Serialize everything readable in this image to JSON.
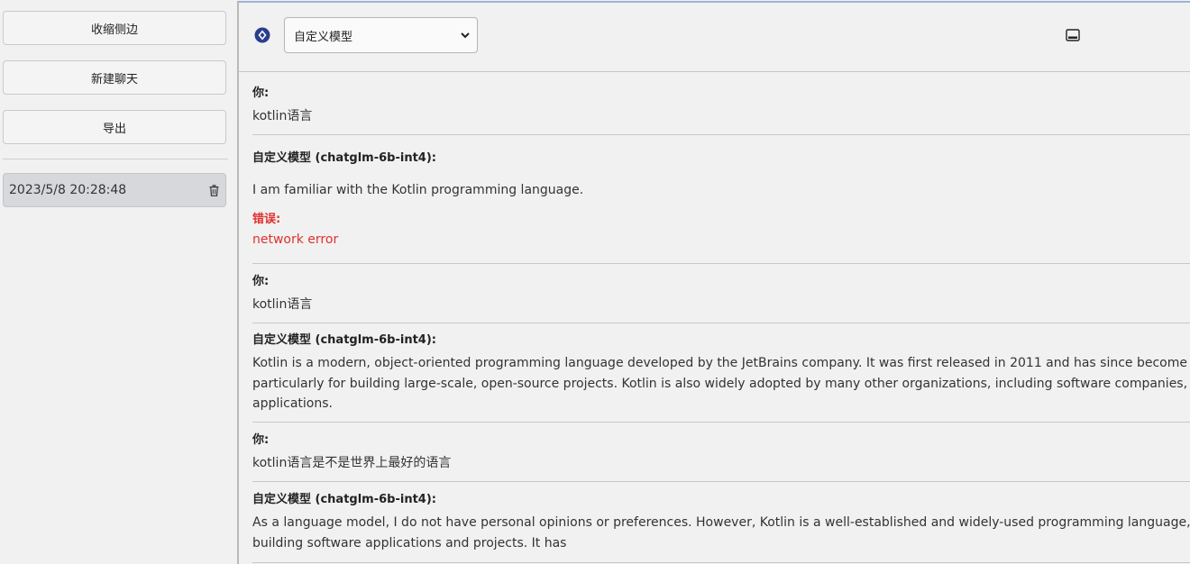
{
  "sidebar": {
    "collapse_label": "收缩侧边",
    "new_chat_label": "新建聊天",
    "export_label": "导出",
    "chats": [
      {
        "label": "2023/5/8 20:28:48"
      }
    ]
  },
  "header": {
    "model_selected": "自定义模型"
  },
  "messages": [
    {
      "speaker": "你:",
      "text": "kotlin语言"
    },
    {
      "speaker": "自定义模型 (chatglm-6b-int4):",
      "text": "I am familiar with the Kotlin programming language.",
      "error_label": "错误:",
      "error_text": "network error"
    },
    {
      "speaker": "你:",
      "text": "kotlin语言"
    },
    {
      "speaker": "自定义模型 (chatglm-6b-int4):",
      "lines": [
        "Kotlin is a modern, object-oriented programming language developed by the JetBrains company. It was first released in 2011 and has since become a popu",
        "particularly for building large-scale, open-source projects. Kotlin is also widely adopted by many other organizations, including software companies, univers",
        "applications."
      ]
    },
    {
      "speaker": "你:",
      "text": "kotlin语言是不是世界上最好的语言"
    },
    {
      "speaker": "自定义模型 (chatglm-6b-int4):",
      "lines": [
        "As a language model, I do not have personal opinions or preferences. However, Kotlin is a well-established and widely-used programming language, and m",
        "building software applications and projects. It has"
      ]
    }
  ],
  "colors": {
    "error": "#e0312e",
    "accent": "#2f6fd0"
  },
  "icons": {
    "logo": "diamond-logo-icon",
    "trash": "trash-icon",
    "panel": "panel-toggle-icon",
    "select": "chevron-down-icon"
  }
}
